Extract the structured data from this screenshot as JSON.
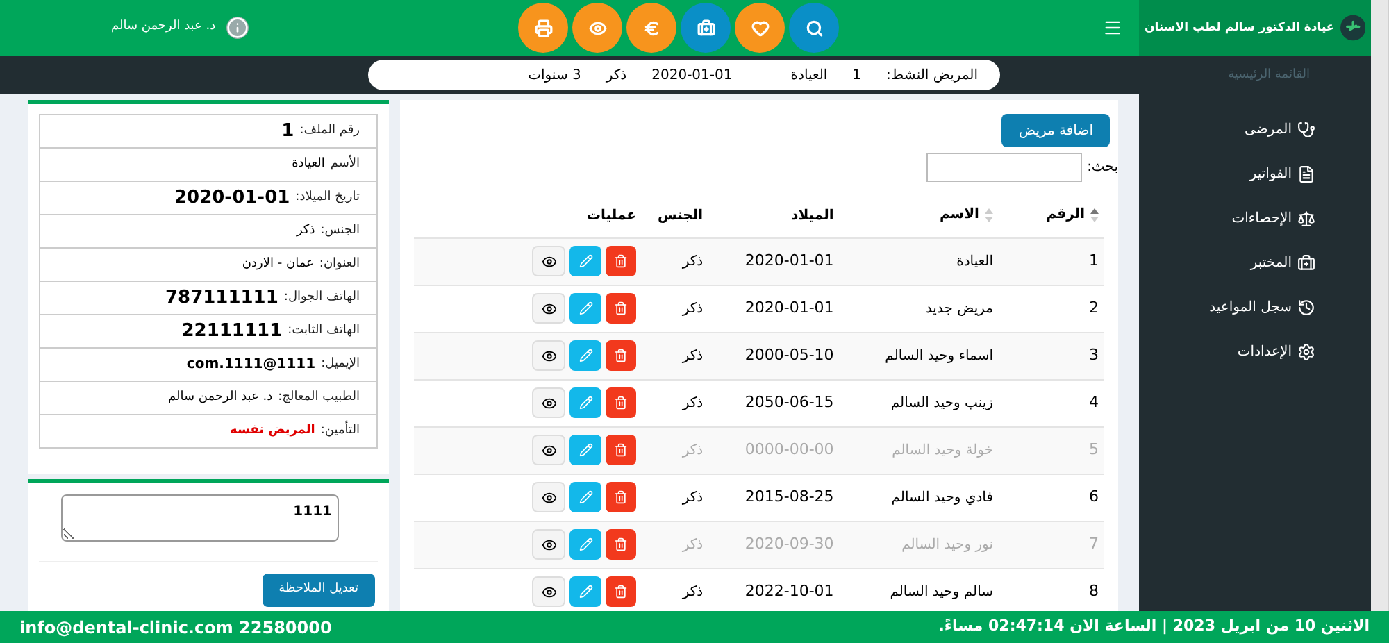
{
  "header": {
    "clinic_title": "عيادة الدكتور سالم لطب الاسنان",
    "user_name": "د. عبد الرحمن سالم",
    "quick_actions": [
      {
        "kind": "search",
        "color": "#0a8fc7"
      },
      {
        "kind": "heart",
        "color": "#f7941d"
      },
      {
        "kind": "medkit",
        "color": "#0a8fc7"
      },
      {
        "kind": "euro",
        "color": "#f7941d"
      },
      {
        "kind": "eye",
        "color": "#f7941d"
      },
      {
        "kind": "print",
        "color": "#f7941d"
      }
    ]
  },
  "sidebar": {
    "heading": "القائمة الرئيسية",
    "items": [
      {
        "label": "المرضى",
        "kind": "stethoscope"
      },
      {
        "label": "الفواتير",
        "kind": "file"
      },
      {
        "label": "الإحصاءات",
        "kind": "scale"
      },
      {
        "label": "المختبر",
        "kind": "medkit"
      },
      {
        "label": "سجل المواعيد",
        "kind": "history"
      },
      {
        "label": "الإعدادات",
        "kind": "settings"
      }
    ]
  },
  "active_patient": {
    "label": "المريض النشط:",
    "file_no": "1",
    "name": "العيادة",
    "birth_date": "2020-01-01",
    "gender": "ذكر",
    "age": "3 سنوات"
  },
  "patients": {
    "add_button": "اضافة مريض",
    "search_label": "بحث:",
    "columns": [
      {
        "label": "الرقم",
        "sortable": true
      },
      {
        "label": "الاسم",
        "sortable": true
      },
      {
        "label": "الميلاد",
        "sortable": false
      },
      {
        "label": "الجنس",
        "sortable": false
      },
      {
        "label": "عمليات",
        "sortable": false
      }
    ],
    "rows": [
      {
        "no": "1",
        "name": "العيادة",
        "birth": "2020-01-01",
        "gender": "ذكر",
        "dimmed": false
      },
      {
        "no": "2",
        "name": "مريض جديد",
        "birth": "2020-01-01",
        "gender": "ذكر",
        "dimmed": false
      },
      {
        "no": "3",
        "name": "اسماء وحيد السالم",
        "birth": "2000-05-10",
        "gender": "ذكر",
        "dimmed": false
      },
      {
        "no": "4",
        "name": "زينب وحيد السالم",
        "birth": "2050-06-15",
        "gender": "ذكر",
        "dimmed": false
      },
      {
        "no": "5",
        "name": "خولة وحيد السالم",
        "birth": "0000-00-00",
        "gender": "ذكر",
        "dimmed": true
      },
      {
        "no": "6",
        "name": "فادي وحيد السالم",
        "birth": "2015-08-25",
        "gender": "ذكر",
        "dimmed": false
      },
      {
        "no": "7",
        "name": "نور وحيد السالم",
        "birth": "2020-09-30",
        "gender": "ذكر",
        "dimmed": true
      },
      {
        "no": "8",
        "name": "سالم وحيد السالم",
        "birth": "2022-10-01",
        "gender": "ذكر",
        "dimmed": false
      }
    ]
  },
  "patient_card": {
    "fields": [
      {
        "label": "رقم الملف:",
        "value": "1",
        "kind": "bold"
      },
      {
        "label": "الأسم",
        "value": "العيادة",
        "kind": "plain"
      },
      {
        "label": "تاريخ الميلاد:",
        "value": "2020-01-01",
        "kind": "bold"
      },
      {
        "label": "الجنس:",
        "value": "ذكر",
        "kind": "plain"
      },
      {
        "label": "العنوان:",
        "value": "عمان - الاردن",
        "kind": "plain"
      },
      {
        "label": "الهاتف الجوال:",
        "value": "787111111",
        "kind": "bold"
      },
      {
        "label": "الهاتف الثابت:",
        "value": "22111111",
        "kind": "bold"
      },
      {
        "label": "الإيميل:",
        "value": "com.1111@1111",
        "kind": "small"
      },
      {
        "label": "الطبيب المعالج:",
        "value": "د. عبد الرحمن سالم",
        "kind": "plain"
      },
      {
        "label": "التأمين:",
        "value": "المريض نفسه",
        "kind": "alert"
      }
    ],
    "note_value": "1111",
    "note_button": "تعديل الملاحظة"
  },
  "footer": {
    "datetime": "الاثنين 10 من ابريل 2023 | الساعة الان 02:47:14 مساءً.",
    "contact": "info@dental-clinic.com 22580000"
  }
}
